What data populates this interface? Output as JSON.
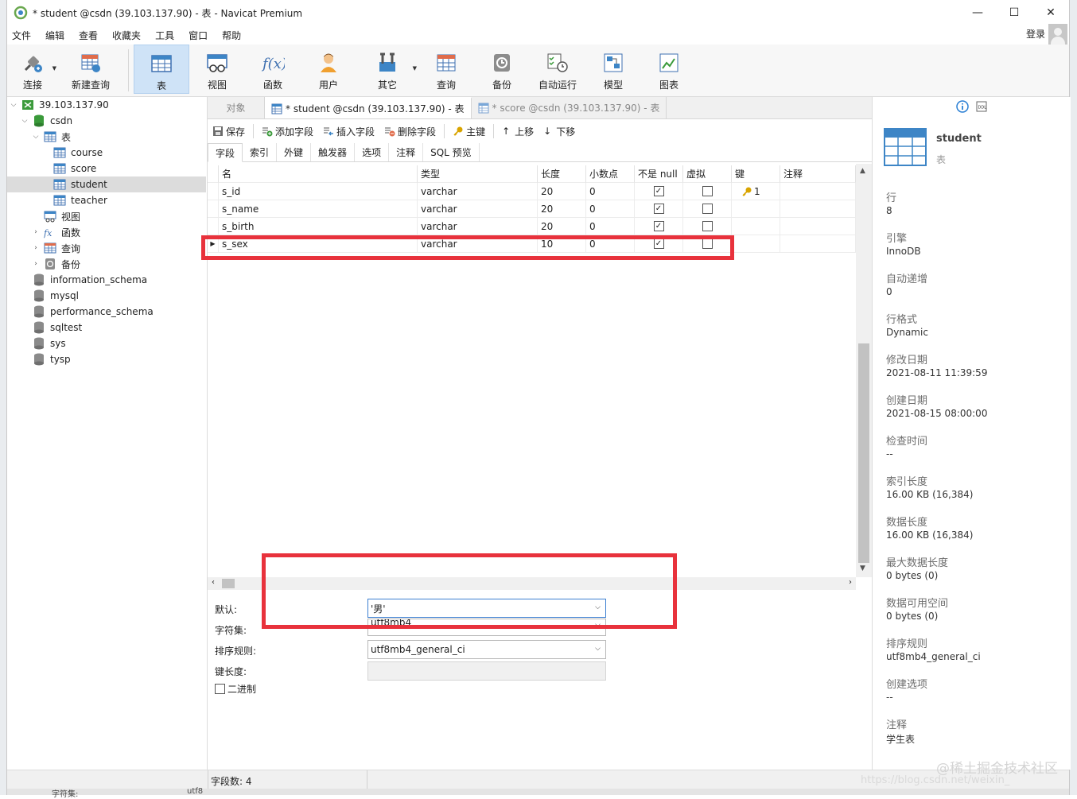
{
  "window": {
    "title": "* student @csdn (39.103.137.90) - 表 - Navicat Premium",
    "controls": [
      "—",
      "☐",
      "✕"
    ]
  },
  "menu": {
    "items": [
      "文件",
      "编辑",
      "查看",
      "收藏夹",
      "工具",
      "窗口",
      "帮助"
    ],
    "login": "登录"
  },
  "toolbar": {
    "items": [
      {
        "label": "连接",
        "icon": "plug-icon"
      },
      {
        "label": "新建查询",
        "icon": "new-query-icon"
      },
      {
        "label": "表",
        "icon": "table-icon"
      },
      {
        "label": "视图",
        "icon": "view-icon"
      },
      {
        "label": "函数",
        "icon": "function-icon"
      },
      {
        "label": "用户",
        "icon": "user-icon"
      },
      {
        "label": "其它",
        "icon": "tools-icon"
      },
      {
        "label": "查询",
        "icon": "query-icon"
      },
      {
        "label": "备份",
        "icon": "backup-icon"
      },
      {
        "label": "自动运行",
        "icon": "autorun-icon"
      },
      {
        "label": "模型",
        "icon": "model-icon"
      },
      {
        "label": "图表",
        "icon": "chart-icon"
      }
    ],
    "active": "表"
  },
  "tree": {
    "server": "39.103.137.90",
    "db": "csdn",
    "tables_group": "表",
    "tables": [
      "course",
      "score",
      "student",
      "teacher"
    ],
    "selected_table": "student",
    "groups": [
      "视图",
      "函数",
      "查询",
      "备份"
    ],
    "databases": [
      "information_schema",
      "mysql",
      "performance_schema",
      "sqltest",
      "sys",
      "tysp"
    ]
  },
  "tabs": {
    "objects": "对象",
    "active": "* student @csdn (39.103.137.90) - 表",
    "inactive": "* score @csdn (39.103.137.90) - 表"
  },
  "editor_toolbar": {
    "save": "保存",
    "add_field": "添加字段",
    "insert_field": "插入字段",
    "delete_field": "删除字段",
    "primary_key": "主键",
    "move_up": "上移",
    "move_down": "下移"
  },
  "field_tabs": [
    "字段",
    "索引",
    "外键",
    "触发器",
    "选项",
    "注释",
    "SQL 预览"
  ],
  "grid": {
    "headers": [
      "名",
      "类型",
      "长度",
      "小数点",
      "不是 null",
      "虚拟",
      "键",
      "注释"
    ],
    "rows": [
      {
        "name": "s_id",
        "type": "varchar",
        "length": "20",
        "decimals": "0",
        "not_null": true,
        "virtual": false,
        "key": "1",
        "comment": ""
      },
      {
        "name": "s_name",
        "type": "varchar",
        "length": "20",
        "decimals": "0",
        "not_null": true,
        "virtual": false,
        "key": "",
        "comment": ""
      },
      {
        "name": "s_birth",
        "type": "varchar",
        "length": "20",
        "decimals": "0",
        "not_null": true,
        "virtual": false,
        "key": "",
        "comment": ""
      },
      {
        "name": "s_sex",
        "type": "varchar",
        "length": "10",
        "decimals": "0",
        "not_null": true,
        "virtual": false,
        "key": "",
        "comment": ""
      }
    ],
    "current_row_marker": "▶"
  },
  "field_props": {
    "default_label": "默认:",
    "default_value": "'男'",
    "charset_label": "字符集:",
    "charset_value": "utf8mb4",
    "collation_label": "排序规则:",
    "collation_value": "utf8mb4_general_ci",
    "key_length_label": "键长度:",
    "binary_label": "二进制"
  },
  "status": {
    "field_count": "字段数: 4"
  },
  "info": {
    "name": "student",
    "type": "表",
    "fields": [
      {
        "label": "行",
        "value": "8"
      },
      {
        "label": "引擎",
        "value": "InnoDB"
      },
      {
        "label": "自动递增",
        "value": "0"
      },
      {
        "label": "行格式",
        "value": "Dynamic"
      },
      {
        "label": "修改日期",
        "value": "2021-08-11 11:39:59"
      },
      {
        "label": "创建日期",
        "value": "2021-08-15 08:00:00"
      },
      {
        "label": "检查时间",
        "value": "--"
      },
      {
        "label": "索引长度",
        "value": "16.00 KB (16,384)"
      },
      {
        "label": "数据长度",
        "value": "16.00 KB (16,384)"
      },
      {
        "label": "最大数据长度",
        "value": "0 bytes (0)"
      },
      {
        "label": "数据可用空间",
        "value": "0 bytes (0)"
      },
      {
        "label": "排序规则",
        "value": "utf8mb4_general_ci"
      },
      {
        "label": "创建选项",
        "value": "--"
      },
      {
        "label": "注释",
        "value": "学生表"
      }
    ]
  },
  "watermark": "@稀土掘金技术社区",
  "watermark_url": "https://blog.csdn.net/weixin_",
  "bottom_strip": {
    "left": "字符集:",
    "mid": "utf8"
  },
  "colors": {
    "highlight": "#e8323c",
    "accent": "#2a7fd4",
    "selected_tab": "#cfe3f7"
  }
}
